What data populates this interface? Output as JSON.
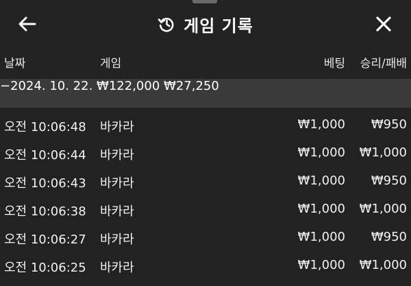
{
  "header": {
    "back_icon": "arrow-left-icon",
    "history_icon": "history-icon",
    "title": "게임 기록",
    "close_icon": "close-icon"
  },
  "columns": {
    "date": "날짜",
    "game": "게임",
    "bet": "베팅",
    "win_loss": "승리/패배"
  },
  "summary": {
    "date": "−2024. 10. 22.",
    "bet_total": "₩122,000",
    "win_total": "₩27,250"
  },
  "rows": [
    {
      "time": "오전 10:06:48",
      "game": "바카라",
      "bet": "₩1,000",
      "result": "₩950"
    },
    {
      "time": "오전 10:06:44",
      "game": "바카라",
      "bet": "₩1,000",
      "result": "₩1,000"
    },
    {
      "time": "오전 10:06:43",
      "game": "바카라",
      "bet": "₩1,000",
      "result": "₩950"
    },
    {
      "time": "오전 10:06:38",
      "game": "바카라",
      "bet": "₩1,000",
      "result": "₩1,000"
    },
    {
      "time": "오전 10:06:27",
      "game": "바카라",
      "bet": "₩1,000",
      "result": "₩950"
    },
    {
      "time": "오전 10:06:25",
      "game": "바카라",
      "bet": "₩1,000",
      "result": "₩1,000"
    }
  ],
  "colors": {
    "background": "#222222",
    "date_band": "#3a3a3a",
    "text": "#ffffff"
  }
}
